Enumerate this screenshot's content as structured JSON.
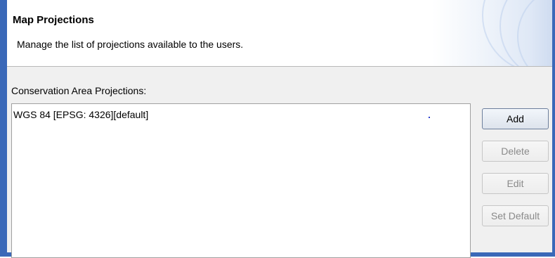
{
  "header": {
    "title": "Map Projections",
    "description": "Manage the list of projections available to the users."
  },
  "projections": {
    "group_label": "Conservation Area Projections:",
    "items": [
      {
        "label": "WGS 84 [EPSG: 4326][default]"
      }
    ]
  },
  "buttons": {
    "add": {
      "label": "Add",
      "enabled": true
    },
    "delete": {
      "label": "Delete",
      "enabled": false
    },
    "edit": {
      "label": "Edit",
      "enabled": false
    },
    "set_default": {
      "label": "Set Default",
      "enabled": false
    }
  },
  "colors": {
    "frame_border": "#3a68b8",
    "panel_background": "#f0f0f0",
    "disabled_text": "#8a8a8a"
  }
}
